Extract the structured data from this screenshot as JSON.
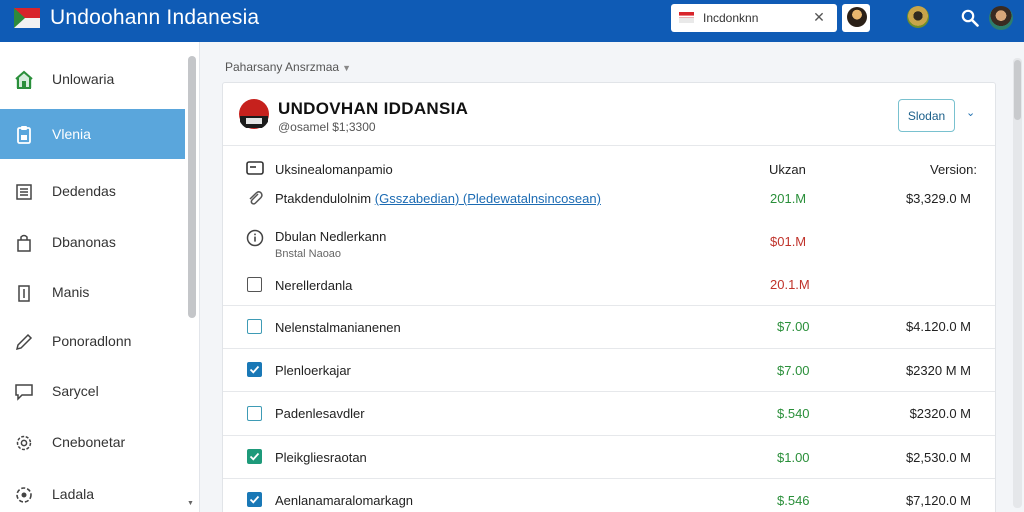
{
  "app": {
    "title": "Undoohann Indanesia"
  },
  "topbar": {
    "search_value": "Incdonknn",
    "icons": [
      "flag-icon",
      "close-icon",
      "search-icon"
    ]
  },
  "sidebar": {
    "items": [
      {
        "label": "Unlowaria",
        "icon": "home-icon"
      },
      {
        "label": "Vlenia",
        "icon": "document-icon",
        "active": true
      },
      {
        "label": "Dedendas",
        "icon": "list-icon"
      },
      {
        "label": "Dbanonas",
        "icon": "bag-icon"
      },
      {
        "label": "Manis",
        "icon": "book-icon"
      },
      {
        "label": "Ponoradlonn",
        "icon": "pencil-icon"
      },
      {
        "label": "Sarycel",
        "icon": "chat-icon"
      },
      {
        "label": "Cnebonetar",
        "icon": "gear-icon"
      },
      {
        "label": "Ladala",
        "icon": "settings-icon"
      }
    ]
  },
  "breadcrumb": {
    "label": "Paharsany Ansrzmaa"
  },
  "card": {
    "title": "UNDOVHAN IDDANSIA",
    "subtitle": "@osamel $1;3300",
    "status_button": "Slodan"
  },
  "table": {
    "header": {
      "label": "Uksinealomanpamio",
      "col1": "Ukzan",
      "col2": "Version:"
    },
    "rows": [
      {
        "label": "Ptakdendulolnim",
        "link": "(Gsszabedian) (Pledewatalnsincosean)",
        "amount": "201.M",
        "amount_color": "green",
        "value": "$3,329.0 M",
        "icon": "attachment-icon"
      },
      {
        "label": "Dbulan Nedlerkann",
        "sub": "Bnstal Naoao",
        "amount": "$01.M",
        "amount_color": "red",
        "value": "",
        "icon": "info-icon"
      },
      {
        "label": "Nerellerdanla",
        "amount": "20.1.M",
        "amount_color": "red",
        "value": "",
        "checkbox": "unchecked"
      },
      {
        "label": "Nelenstalmanianenen",
        "amount": "$7.00",
        "amount_color": "green",
        "value": "$4.120.0 M",
        "checkbox": "unchecked-teal"
      },
      {
        "label": "Plenloerkajar",
        "amount": "$7.00",
        "amount_color": "green",
        "value": "$2320 M M",
        "checkbox": "checked-blue"
      },
      {
        "label": "Padenlesavdler",
        "amount": "$.540",
        "amount_color": "green",
        "value": "$2320.0 M",
        "checkbox": "unchecked-teal"
      },
      {
        "label": "Pleikgliesraotan",
        "amount": "$1.00",
        "amount_color": "green",
        "value": "$2,530.0 M",
        "checkbox": "checked-green"
      },
      {
        "label": "Aenlanamaralomarkagn",
        "amount": "$.546",
        "amount_color": "green",
        "value": "$7,120.0 M",
        "checkbox": "checked-blue"
      }
    ]
  },
  "colors": {
    "topbar": "#0f5bb5",
    "active_item": "#5aa6dc",
    "green": "#2a8f3a",
    "red": "#c0332b",
    "link": "#1c6bb3"
  }
}
